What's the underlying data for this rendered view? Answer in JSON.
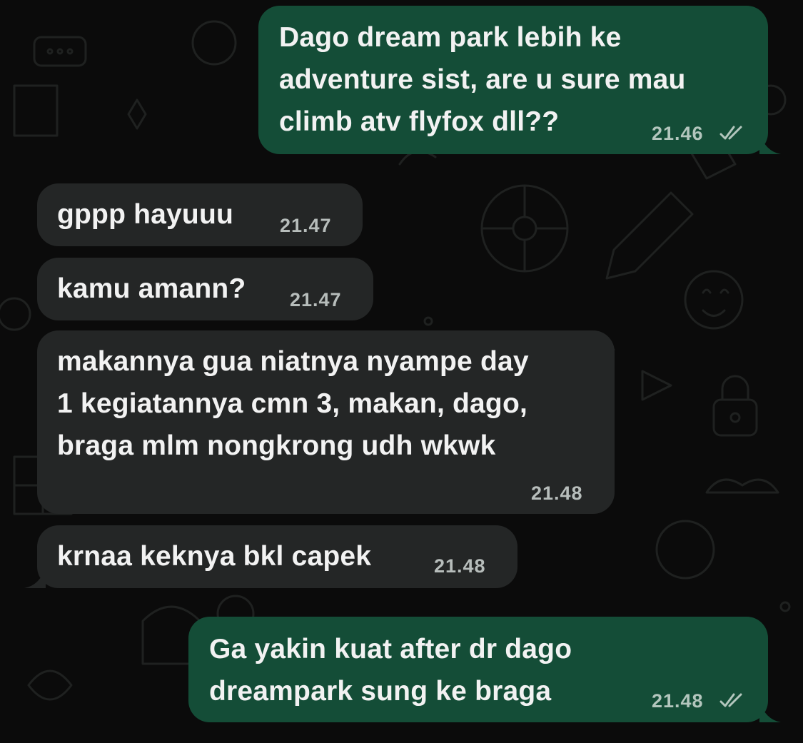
{
  "colors": {
    "background": "#0b0b0b",
    "outgoing_bubble": "#144d37",
    "incoming_bubble": "#242626",
    "text": "#f2f2f2",
    "timestamp": "#b7bdbb"
  },
  "messages": [
    {
      "direction": "outgoing",
      "text": "Dago dream park lebih ke\nadventure sist, are u sure mau\nclimb atv flyfox dll??",
      "time": "21.46",
      "status_icon": "double-check-icon"
    },
    {
      "direction": "incoming",
      "text": "gppp hayuuu",
      "time": "21.47"
    },
    {
      "direction": "incoming",
      "text": "kamu amann?",
      "time": "21.47"
    },
    {
      "direction": "incoming",
      "text": "makannya gua niatnya nyampe day\n1 kegiatannya cmn 3, makan, dago,\nbraga mlm nongkrong udh wkwk",
      "time": "21.48"
    },
    {
      "direction": "incoming",
      "text": "krnaa keknya bkl capek",
      "time": "21.48"
    },
    {
      "direction": "outgoing",
      "text": "Ga yakin kuat after dr dago\ndreampark sung ke braga",
      "time": "21.48",
      "status_icon": "double-check-icon"
    }
  ]
}
